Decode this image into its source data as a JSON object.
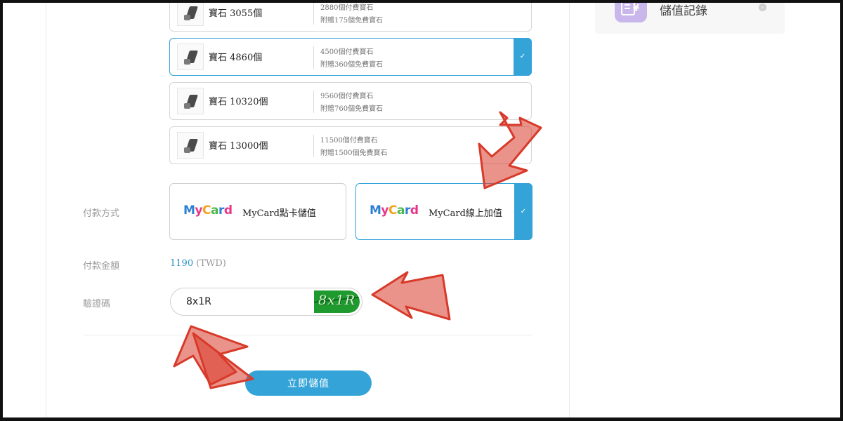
{
  "packages": [
    {
      "name": "寶石 3055個",
      "paid": "2880個付費寶石",
      "bonus": "附贈175個免費寶石",
      "selected": false
    },
    {
      "name": "寶石 4860個",
      "paid": "4500個付費寶石",
      "bonus": "附贈360個免費寶石",
      "selected": true
    },
    {
      "name": "寶石 10320個",
      "paid": "9560個付費寶石",
      "bonus": "附贈760個免費寶石",
      "selected": false
    },
    {
      "name": "寶石 13000個",
      "paid": "11500個付費寶石",
      "bonus": "附贈1500個免費寶石",
      "selected": false
    }
  ],
  "payment": {
    "label": "付款方式",
    "methods": [
      {
        "title": "MyCard點卡儲值",
        "selected": false
      },
      {
        "title": "MyCard線上加值",
        "selected": true
      }
    ],
    "logo_text": "MyCard"
  },
  "amount": {
    "label": "付款金額",
    "value": "1190",
    "currency": "(TWD)"
  },
  "captcha": {
    "label": "驗證碼",
    "value": "8x1R",
    "image_text": "8x1R"
  },
  "submit_label": "立即儲值",
  "sidebar": {
    "history_label": "儲值記錄",
    "history_icon": "receipt-yen-icon"
  },
  "icons": {
    "check": "✓"
  },
  "colors": {
    "accent": "#33a3d8",
    "annotation": "#d83a2a"
  }
}
